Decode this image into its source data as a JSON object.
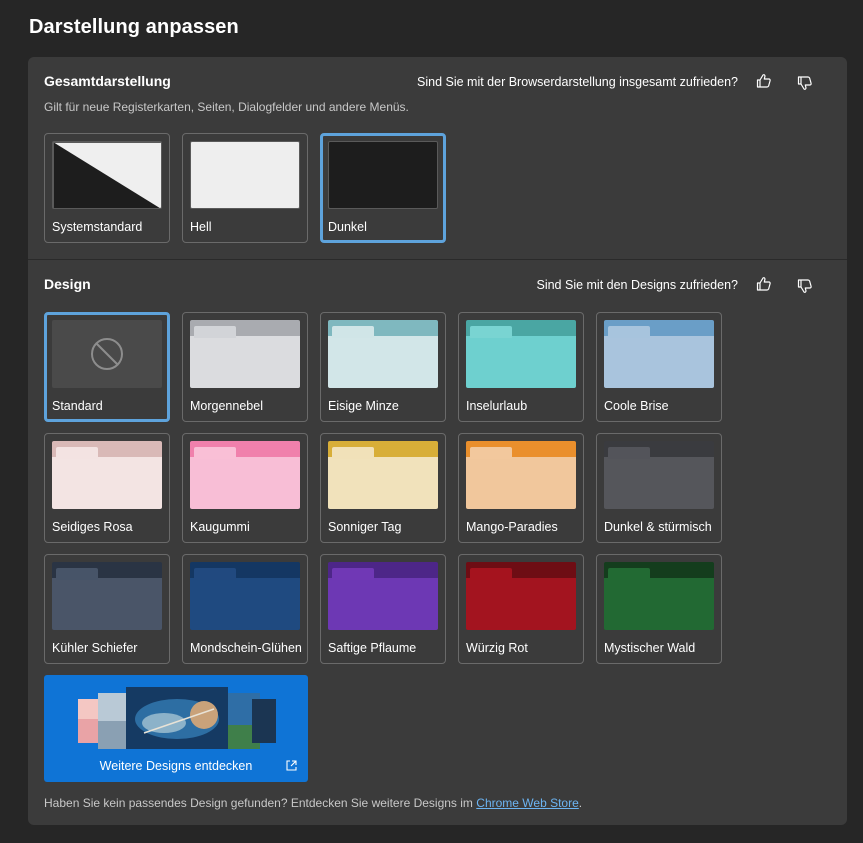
{
  "page": {
    "title": "Darstellung anpassen"
  },
  "overall": {
    "title": "Gesamtdarstellung",
    "subtitle": "Gilt für neue Registerkarten, Seiten, Dialogfelder und andere Menüs.",
    "feedback_question": "Sind Sie mit der Browserdarstellung insgesamt zufrieden?",
    "options": [
      {
        "label": "Systemstandard",
        "selected": false
      },
      {
        "label": "Hell",
        "selected": false
      },
      {
        "label": "Dunkel",
        "selected": true
      }
    ]
  },
  "design": {
    "title": "Design",
    "feedback_question": "Sind Sie mit den Designs zufrieden?",
    "themes": [
      {
        "label": "Standard",
        "selected": true,
        "icon": "no-theme-icon",
        "bg": "#4a4a4a"
      },
      {
        "label": "Morgennebel",
        "band": "#a9abb0",
        "tab": "#d2d4d8",
        "body": "#dbdcdf"
      },
      {
        "label": "Eisige Minze",
        "band": "#7fb8bf",
        "tab": "#d0e5e7",
        "body": "#d2e6e8"
      },
      {
        "label": "Inselurlaub",
        "band": "#4aa6a3",
        "tab": "#79d4d2",
        "body": "#6ed0cf"
      },
      {
        "label": "Coole Brise",
        "band": "#6a9ec7",
        "tab": "#a7c4dd",
        "body": "#a9c4dd"
      },
      {
        "label": "Seidiges Rosa",
        "band": "#d9b9b7",
        "tab": "#f3e3e2",
        "body": "#f3e4e3"
      },
      {
        "label": "Kaugummi",
        "band": "#f080ac",
        "tab": "#f9bfd6",
        "body": "#f8bed6"
      },
      {
        "label": "Sonniger Tag",
        "band": "#d8ae38",
        "tab": "#f1e1b9",
        "body": "#f1e2bb"
      },
      {
        "label": "Mango-Paradies",
        "band": "#ea8f2c",
        "tab": "#f2c89d",
        "body": "#f1c79c"
      },
      {
        "label": "Dunkel & stürmisch",
        "band": "#3a3b3f",
        "tab": "#53545a",
        "body": "#55565b"
      },
      {
        "label": "Kühler Schiefer",
        "band": "#2a3444",
        "tab": "#475468",
        "body": "#4a5568"
      },
      {
        "label": "Mondschein-Glühen",
        "band": "#143763",
        "tab": "#21497f",
        "body": "#1f4a80"
      },
      {
        "label": "Saftige Pflaume",
        "band": "#4d2688",
        "tab": "#7038b5",
        "body": "#6d38b4"
      },
      {
        "label": "Würzig Rot",
        "band": "#6e0d14",
        "tab": "#a5131e",
        "body": "#a3141f"
      },
      {
        "label": "Mystischer Wald",
        "band": "#143d1d",
        "tab": "#226a33",
        "body": "#226933"
      }
    ],
    "more_designs": {
      "label": "Weitere Designs entdecken",
      "icon": "external-link-icon"
    },
    "footer": {
      "text": "Haben Sie kein passendes Design gefunden? Entdecken Sie weitere Designs im",
      "link": "Chrome Web Store",
      "suffix": "."
    }
  },
  "colors": {
    "accent": "#5ea3dc",
    "promo": "#0f74d6",
    "card": "#3b3b3b",
    "page": "#262626"
  }
}
